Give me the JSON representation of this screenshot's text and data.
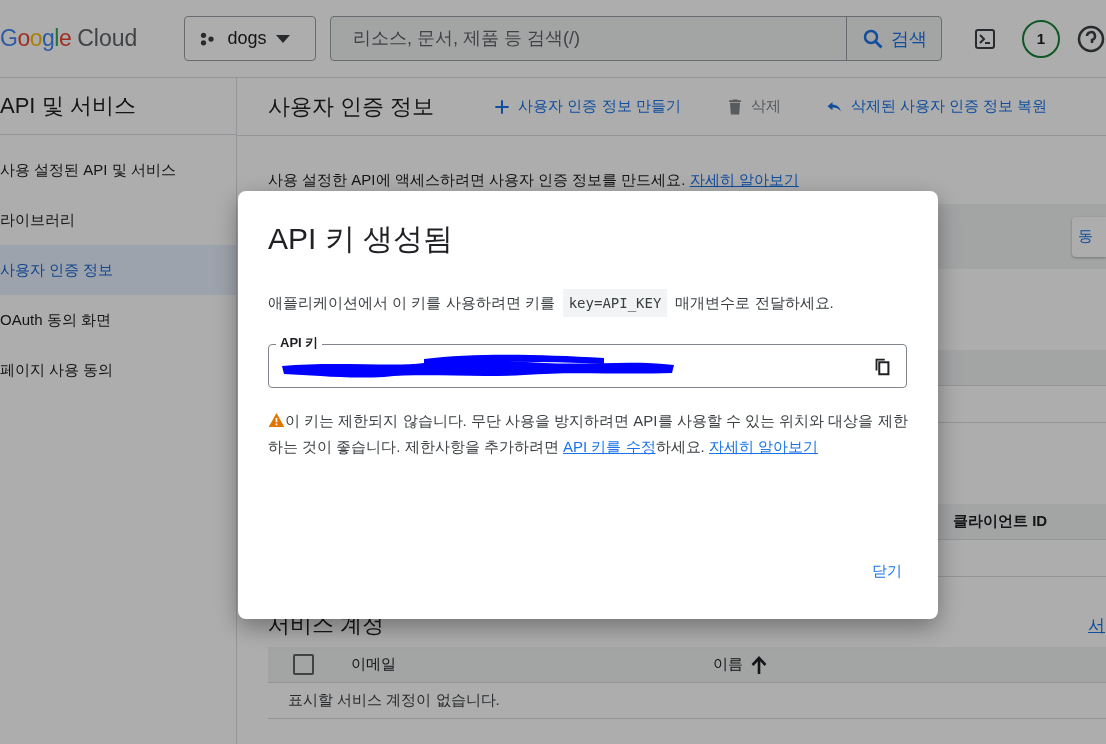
{
  "header": {
    "logo_brand": "Google",
    "logo_product": "Cloud",
    "project": "dogs",
    "search": {
      "placeholder": "리소스, 문서, 제품 등 검색(/)",
      "button": "검색"
    },
    "notification_count": "1"
  },
  "sidebar": {
    "title": "API 및 서비스",
    "items": [
      {
        "label": "사용 설정된 API 및 서비스",
        "selected": false
      },
      {
        "label": "라이브러리",
        "selected": false
      },
      {
        "label": "사용자 인증 정보",
        "selected": true
      },
      {
        "label": "OAuth 동의 화면",
        "selected": false
      },
      {
        "label": "페이지 사용 동의",
        "selected": false
      }
    ]
  },
  "page": {
    "title": "사용자 인증 정보",
    "actions": [
      {
        "label": "사용자 인증 정보 만들기",
        "kind": "create",
        "disabled": false
      },
      {
        "label": "삭제",
        "kind": "delete",
        "disabled": true
      },
      {
        "label": "삭제된 사용자 인증 정보 복원",
        "kind": "restore",
        "disabled": false
      }
    ],
    "intro": "사용 설정한 API에 액세스하려면 사용자 인증 정보를 만드세요.",
    "intro_link": "자세히 알아보기",
    "banner_button": "동",
    "client_table_column": "클라이언트 ID",
    "service_accounts": {
      "title": "서비스 계정",
      "link": "서",
      "select_all_checked": false,
      "columns": [
        {
          "label": "이메일",
          "sorted": false
        },
        {
          "label": "이름",
          "sorted": true
        }
      ],
      "empty": "표시할 서비스 계정이 없습니다."
    }
  },
  "dialog": {
    "title": "API 키 생성됨",
    "text_before": "애플리케이션에서 이 키를 사용하려면 키를",
    "code": "key=API_KEY",
    "text_after": "매개변수로 전달하세요.",
    "field_label": "API 키",
    "warning": "이 키는 제한되지 않습니다. 무단 사용을 방지하려면 API를 사용할 수 있는 위치와 대상을 제한하는 것이 좋습니다. 제한사항을 추가하려면",
    "warning_link": "API 키를 수정",
    "warning_after": "하세요.",
    "learn_more": "자세히 알아보기",
    "close": "닫기"
  }
}
